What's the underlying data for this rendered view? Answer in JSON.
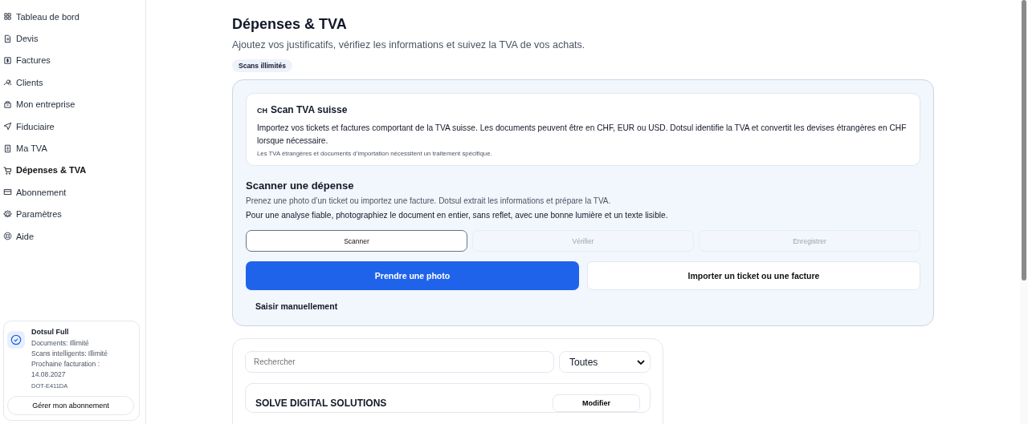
{
  "sidebar": {
    "items": [
      {
        "label": "Tableau de bord",
        "selected": false
      },
      {
        "label": "Devis",
        "selected": false
      },
      {
        "label": "Factures",
        "selected": false
      },
      {
        "label": "Clients",
        "selected": false
      },
      {
        "label": "Mon entreprise",
        "selected": false
      },
      {
        "label": "Fiduciaire",
        "selected": false
      },
      {
        "label": "Ma TVA",
        "selected": false
      },
      {
        "label": "Dépenses & TVA",
        "selected": true
      },
      {
        "label": "Abonnement",
        "selected": false
      },
      {
        "label": "Paramètres",
        "selected": false
      },
      {
        "label": "Aide",
        "selected": false
      }
    ],
    "plan": {
      "name": "Dotsul Full",
      "lines": [
        "Documents: Illimité",
        "Scans intelligents: Illimité",
        "Prochaine facturation : 14.08.2027"
      ],
      "code": "DOT-E411DA",
      "button": "Gérer mon abonnement"
    }
  },
  "page": {
    "title": "Dépenses & TVA",
    "subtitle": "Ajoutez vos justificatifs, vérifiez les informations et suivez la TVA de vos achats.",
    "badge": "Scans illimités"
  },
  "scan_panel": {
    "info": {
      "flag": "CH",
      "title": "Scan TVA suisse",
      "text": "Importez vos tickets et factures comportant de la TVA suisse. Les documents peuvent être en CHF, EUR ou USD. Dotsul identifie la TVA et convertit les devises étrangères en CHF lorsque nécessaire.",
      "note": "Les TVA étrangères et documents d’importation nécessitent un traitement spécifique."
    },
    "title": "Scanner une dépense",
    "subtitle": "Prenez une photo d’un ticket ou importez une facture. Dotsul extrait les informations et prépare la TVA.",
    "tip": "Pour une analyse fiable, photographiez le document en entier, sans reflet, avec une bonne lumière et un texte lisible.",
    "steps": [
      {
        "label": "Scanner",
        "selected": true
      },
      {
        "label": "Vérifier",
        "selected": false
      },
      {
        "label": "Enregistrer",
        "selected": false
      }
    ],
    "primary_button": "Prendre une photo",
    "secondary_button": "Importer un ticket ou une facture",
    "manual_link": "Saisir manuellement"
  },
  "list": {
    "search": {
      "placeholder": "Rechercher"
    },
    "filter": "Toutes",
    "items": [
      {
        "name": "SOLVE DIGITAL SOLUTIONS",
        "button": "Modifier"
      }
    ]
  }
}
